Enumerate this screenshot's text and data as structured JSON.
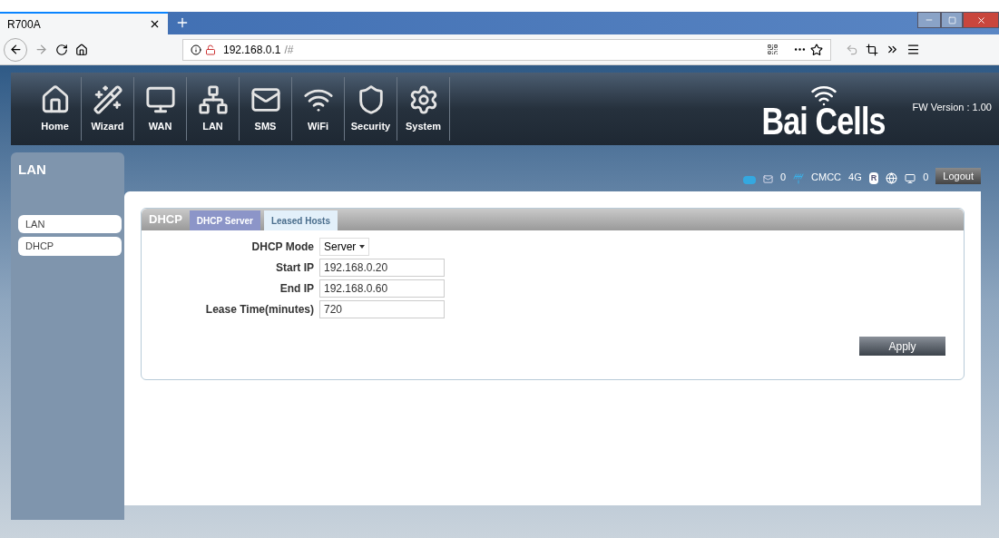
{
  "browser": {
    "tabs": [
      {
        "title": "R700A",
        "selected": true
      }
    ],
    "url": {
      "host": "192.168.0.1",
      "path": "/#"
    }
  },
  "nav": [
    {
      "label": "Home",
      "kind": "home"
    },
    {
      "label": "Wizard",
      "kind": "wizard"
    },
    {
      "label": "WAN",
      "kind": "wan"
    },
    {
      "label": "LAN",
      "kind": "lan"
    },
    {
      "label": "SMS",
      "kind": "sms"
    },
    {
      "label": "WiFi",
      "kind": "wifi"
    },
    {
      "label": "Security",
      "kind": "security"
    },
    {
      "label": "System",
      "kind": "system"
    }
  ],
  "logo": {
    "word1": "Bai",
    "word2": "Cells"
  },
  "fw_version": "FW Version : 1.00",
  "sidebar": {
    "title": "LAN",
    "items": [
      {
        "label": "LAN"
      },
      {
        "label": "DHCP"
      }
    ]
  },
  "status": {
    "sms_count": "0",
    "operator": "CMCC",
    "network": "4G",
    "roaming": "R",
    "device_count": "0",
    "logout": "Logout"
  },
  "panel": {
    "title": "DHCP",
    "tabs": [
      {
        "label": "DHCP Server",
        "selected": true
      },
      {
        "label": "Leased Hosts",
        "selected": false
      }
    ],
    "fields": [
      {
        "label": "DHCP Mode",
        "kind": "select",
        "value": "Server"
      },
      {
        "label": "Start IP",
        "kind": "input",
        "value": "192.168.0.20"
      },
      {
        "label": "End IP",
        "kind": "input",
        "value": "192.168.0.60"
      },
      {
        "label": "Lease Time(minutes)",
        "kind": "input",
        "value": "720"
      }
    ],
    "apply": "Apply"
  }
}
